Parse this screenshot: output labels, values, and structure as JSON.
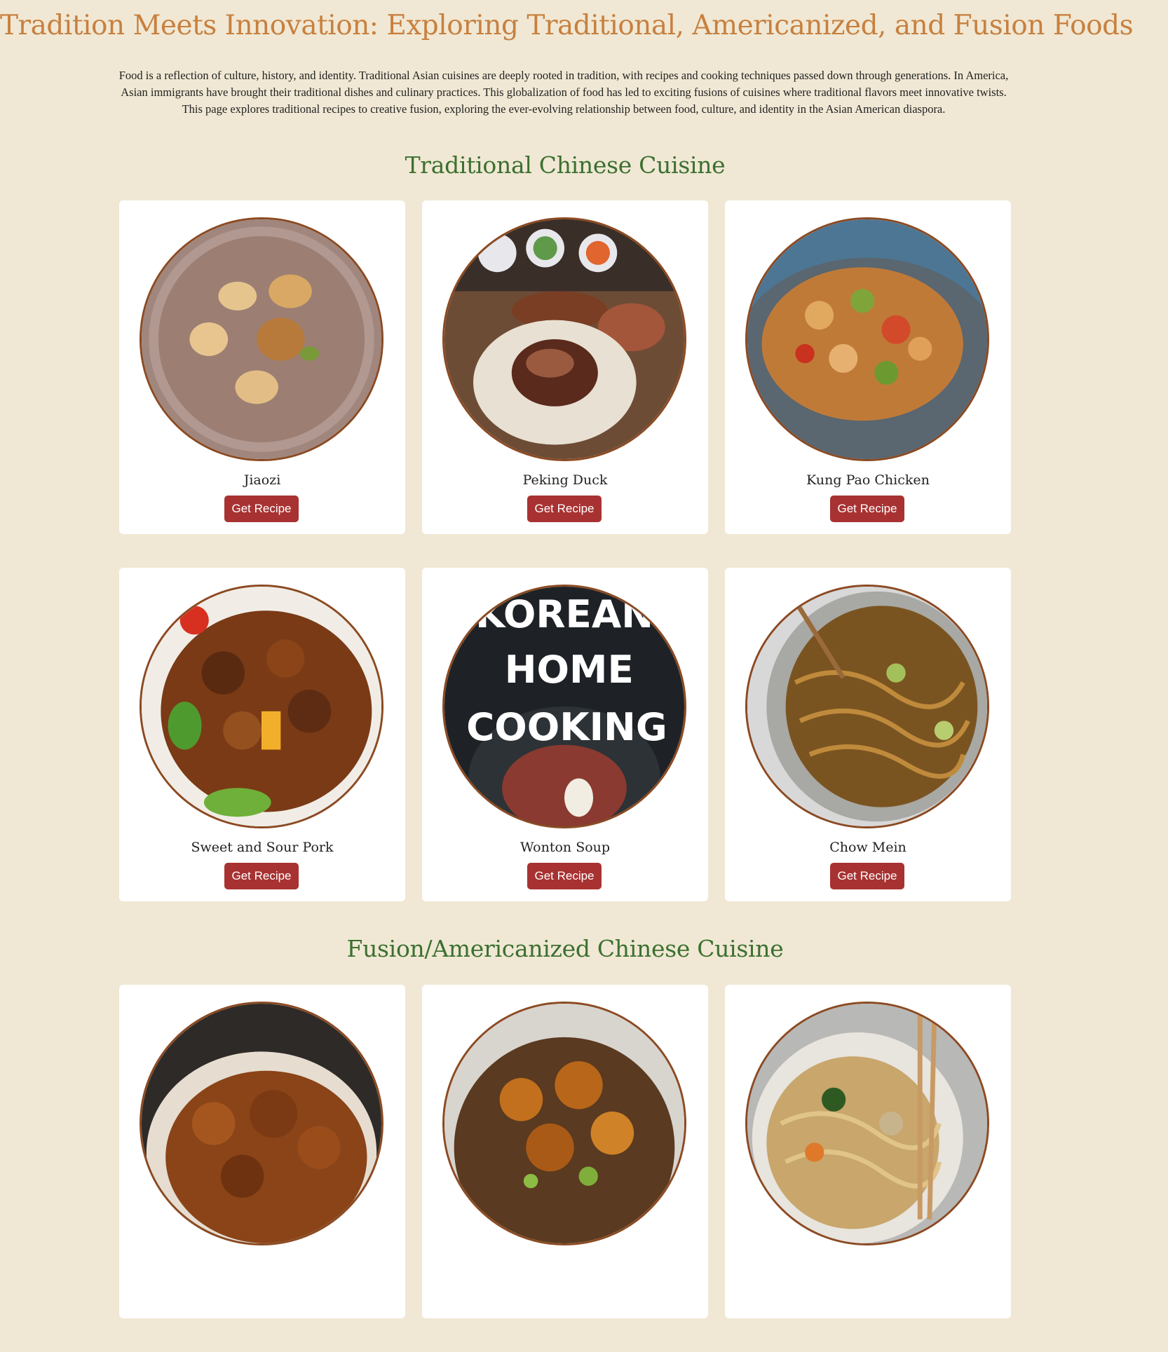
{
  "page": {
    "title": "Tradition Meets Innovation: Exploring Traditional, Americanized, and Fusion Foods",
    "intro": "Food is a reflection of culture, history, and identity. Traditional Asian cuisines are deeply rooted in tradition, with recipes and cooking techniques passed down through generations. In America, Asian immigrants have brought their traditional dishes and culinary practices. This globalization of food has led to exciting fusions of cuisines where traditional flavors meet innovative twists. This page explores traditional recipes to creative fusion, exploring the ever-evolving relationship between food, culture, and identity in the Asian American diaspora."
  },
  "sections": [
    {
      "title": "Traditional Chinese Cuisine",
      "dishes": [
        {
          "name": "Jiaozi",
          "button": "Get Recipe",
          "image": "dumplings-plate"
        },
        {
          "name": "Peking Duck",
          "button": "Get Recipe",
          "image": "peking-duck-wrap"
        },
        {
          "name": "Kung Pao Chicken",
          "button": "Get Recipe",
          "image": "kung-pao-bowl"
        },
        {
          "name": "Sweet and Sour Pork",
          "button": "Get Recipe",
          "image": "sweet-sour-pork"
        },
        {
          "name": "Wonton Soup",
          "button": "Get Recipe",
          "image": "korean-home-cooking-cover",
          "image_text": [
            "KOREAN",
            "HOME",
            "COOKING"
          ]
        },
        {
          "name": "Chow Mein",
          "button": "Get Recipe",
          "image": "chow-mein-noodles"
        }
      ]
    },
    {
      "title": "Fusion/Americanized Chinese Cuisine",
      "dishes": [
        {
          "image": "orange-chicken"
        },
        {
          "image": "general-tso-chicken"
        },
        {
          "image": "lo-mein-noodles"
        }
      ]
    }
  ],
  "colors": {
    "background": "#f0e8d4",
    "title": "#c8803f",
    "section_title": "#3c7030",
    "button": "#a83232",
    "image_border": "#8b4a22"
  }
}
